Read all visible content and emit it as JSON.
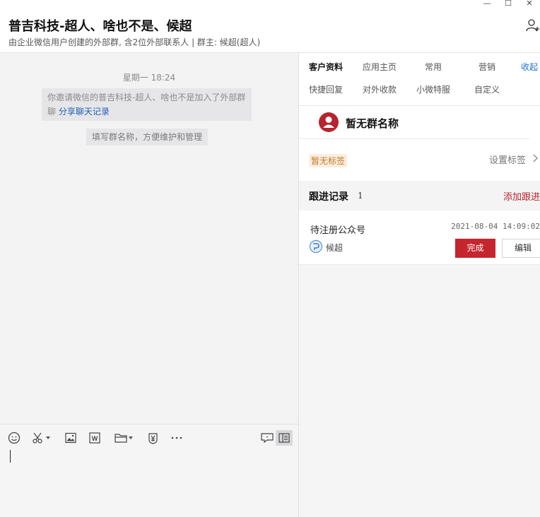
{
  "window": {
    "title": "普吉科技-超人、啥也不是、候超",
    "subtitle": "由企业微信用户创建的外部群, 含2位外部联系人 | 群主: 候超(超人)",
    "controls": [
      "—",
      "☐",
      "✕"
    ]
  },
  "chat": {
    "time_label": "星期一 18:24",
    "system_message": "你邀请微信的普吉科技-超人、啥也不是加入了外部群聊",
    "system_message_link": "分享聊天记录",
    "hint_message": "填写群名称，方便维护和管理"
  },
  "toolbar": {
    "icons": [
      "emoji-icon",
      "scissors-icon",
      "image-icon",
      "word-file-icon",
      "folder-icon",
      "yuan-icon",
      "more-icon",
      "chat-window-icon",
      "sidebar-toggle-icon"
    ]
  },
  "right_panel": {
    "tabs_row1": [
      "客户资料",
      "应用主页",
      "常用",
      "营销",
      "收起"
    ],
    "tabs_row2": [
      "快捷回复",
      "对外收款",
      "小微特服",
      "自定义"
    ],
    "group_name": "暂无群名称",
    "tag": "暂无标签",
    "set_tag": "设置标签",
    "follow_title": "跟进记录",
    "follow_count": "1",
    "follow_add": "添加跟进",
    "record": {
      "title": "待注册公众号",
      "time": "2021-08-04 14:09:02",
      "owner": "候超",
      "done_label": "完成",
      "edit_label": "编辑"
    }
  },
  "colors": {
    "accent_red": "#c5252d",
    "link_blue": "#1f5fb4",
    "tag_bg": "#fbeedd",
    "tag_text": "#c07a2a"
  }
}
